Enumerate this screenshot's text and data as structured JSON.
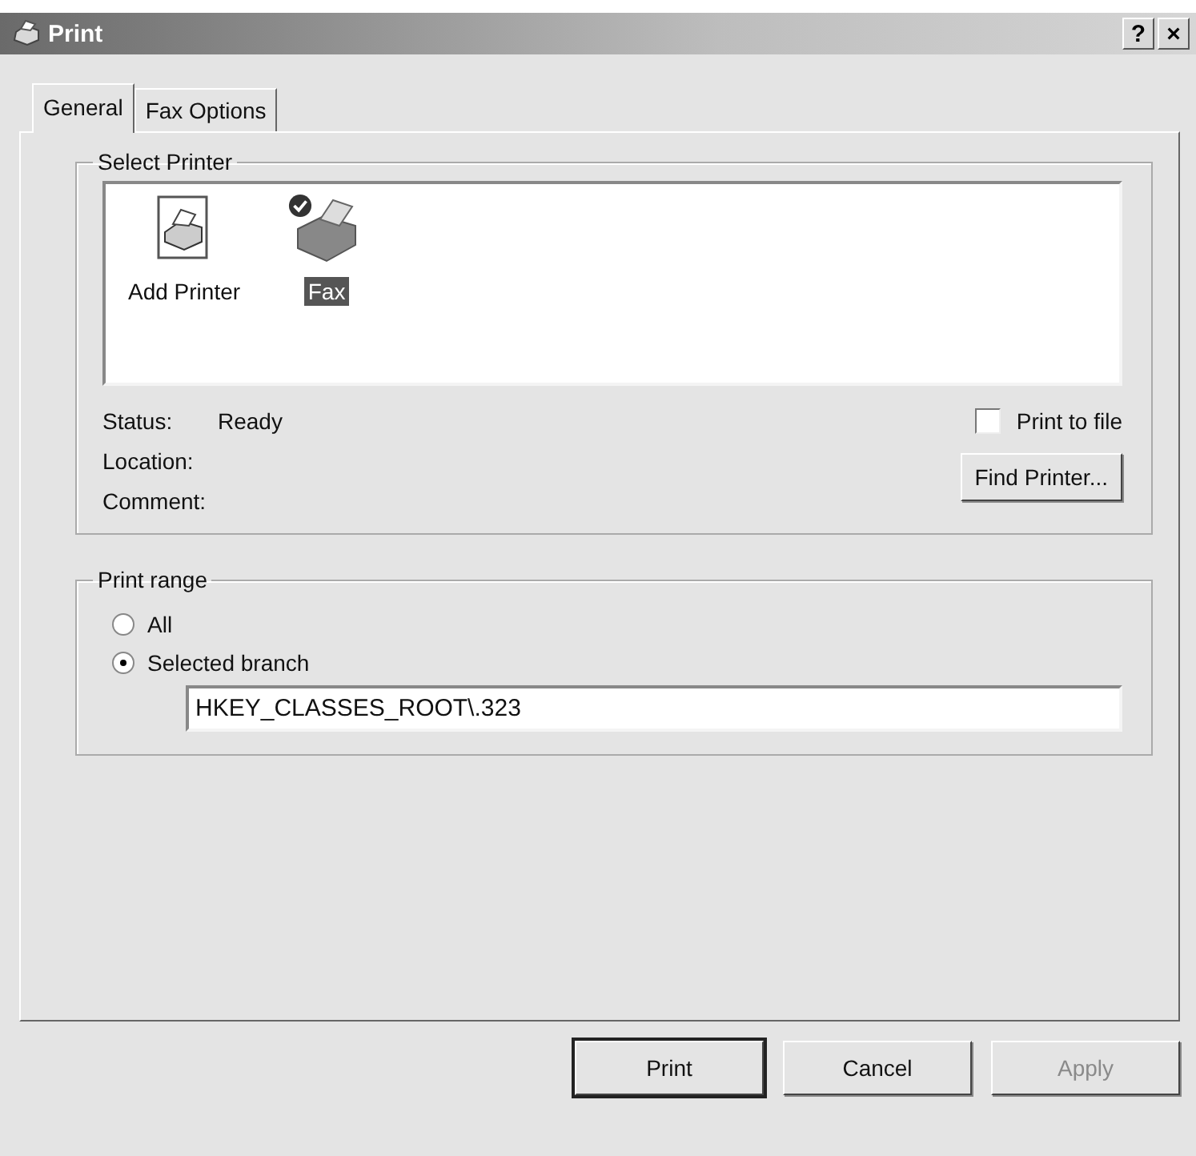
{
  "window": {
    "title": "Print",
    "help_button": "?",
    "close_button": "×"
  },
  "tabs": [
    {
      "label": "General",
      "selected": true
    },
    {
      "label": "Fax Options",
      "selected": false
    }
  ],
  "select_printer": {
    "title": "Select Printer",
    "printers": [
      {
        "name": "Add Printer",
        "kind": "add",
        "selected": false,
        "default": false
      },
      {
        "name": "Fax",
        "kind": "fax",
        "selected": true,
        "default": true
      }
    ],
    "status_label": "Status:",
    "status_value": "Ready",
    "location_label": "Location:",
    "comment_label": "Comment:",
    "print_to_file": {
      "label": "Print to file",
      "checked": false
    },
    "find_printer_button": "Find Printer..."
  },
  "print_range": {
    "title": "Print range",
    "options": [
      {
        "label": "All",
        "selected": false
      },
      {
        "label": "Selected branch",
        "selected": true
      }
    ],
    "branch_value": "HKEY_CLASSES_ROOT\\.323"
  },
  "buttons": [
    {
      "label": "Print",
      "default": true,
      "disabled": false
    },
    {
      "label": "Cancel",
      "default": false,
      "disabled": false
    },
    {
      "label": "Apply",
      "default": false,
      "disabled": true
    }
  ]
}
